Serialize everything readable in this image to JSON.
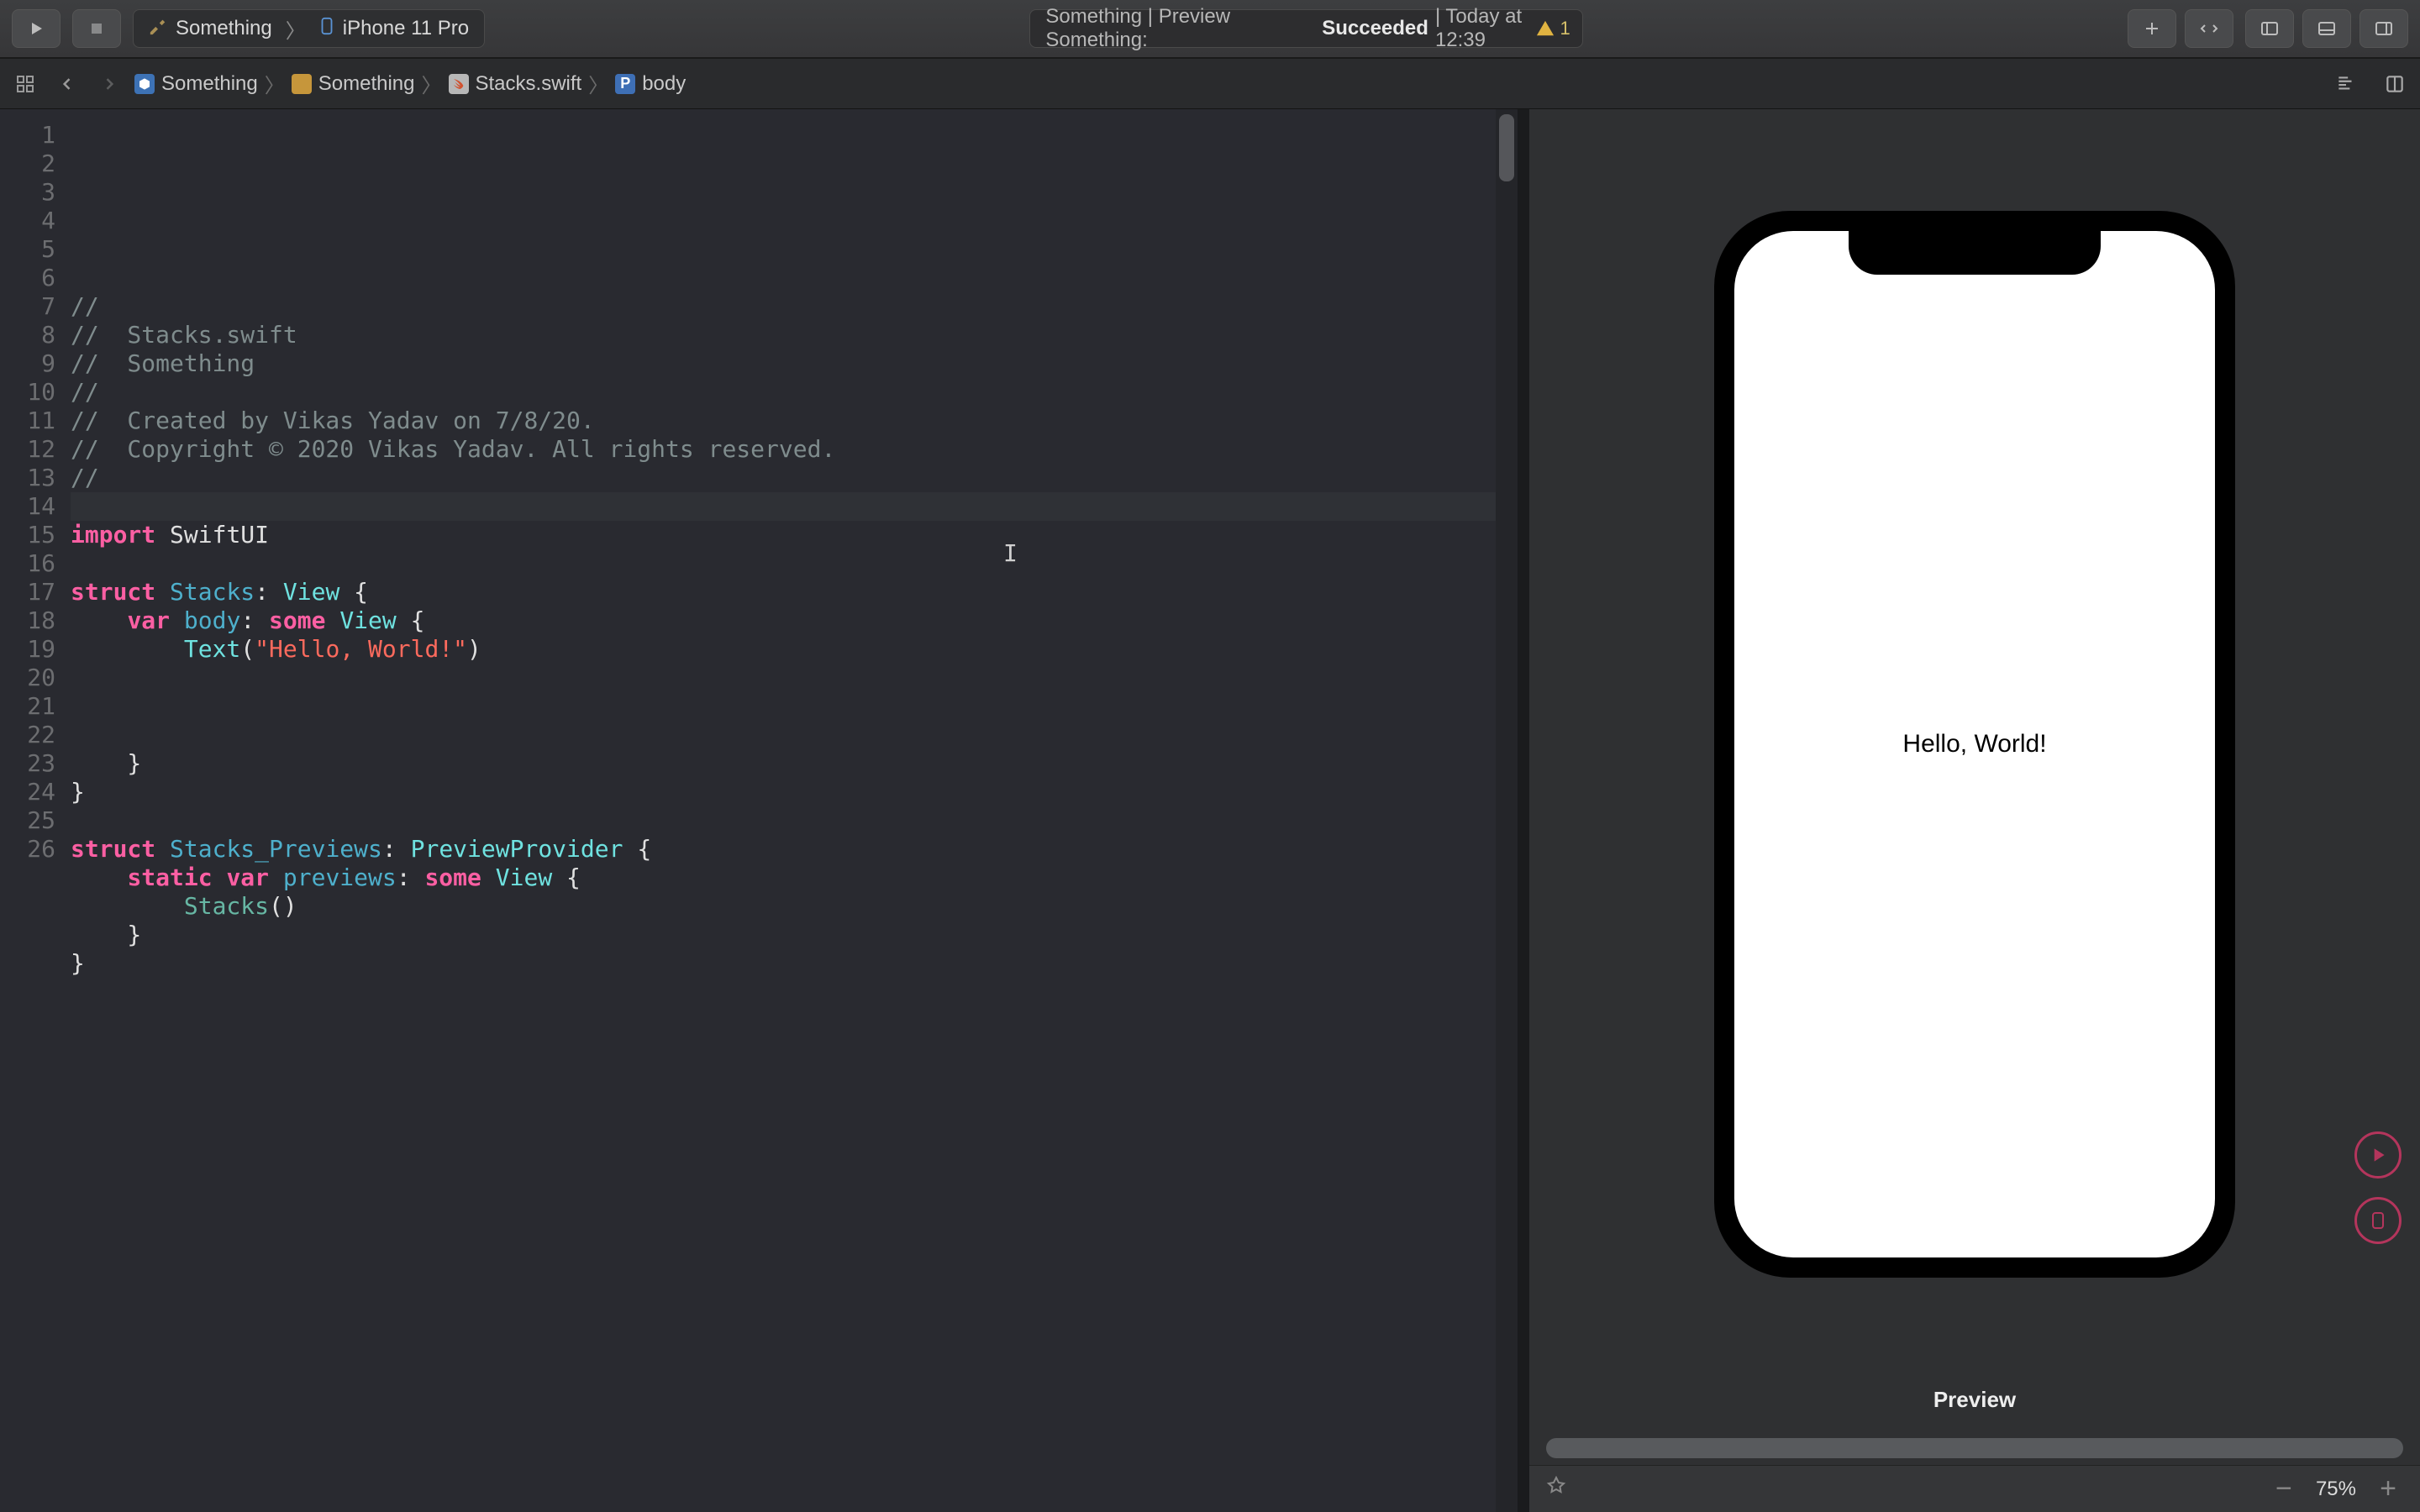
{
  "toolbar": {
    "scheme_target": "Something",
    "scheme_device": "iPhone 11 Pro"
  },
  "status": {
    "prefix": "Something | Preview Something:",
    "state": "Succeeded",
    "suffix": "| Today at 12:39",
    "warn_count": "1"
  },
  "breadcrumbs": {
    "project": "Something",
    "folder": "Something",
    "file": "Stacks.swift",
    "symbol_badge": "P",
    "symbol": "body"
  },
  "code": {
    "lines": [
      "//",
      "//  Stacks.swift",
      "//  Something",
      "//",
      "//  Created by Vikas Yadav on 7/8/20.",
      "//  Copyright © 2020 Vikas Yadav. All rights reserved.",
      "//",
      "",
      "import SwiftUI",
      "",
      "struct Stacks: View {",
      "    var body: some View {",
      "        Text(\"Hello, World!\")",
      "",
      "",
      "",
      "    }",
      "}",
      "",
      "struct Stacks_Previews: PreviewProvider {",
      "    static var previews: some View {",
      "        Stacks()",
      "    }",
      "}",
      "",
      ""
    ],
    "highlighted_line_index": 13
  },
  "canvas": {
    "preview_text": "Hello, World!",
    "label": "Preview",
    "zoom": "75%"
  }
}
